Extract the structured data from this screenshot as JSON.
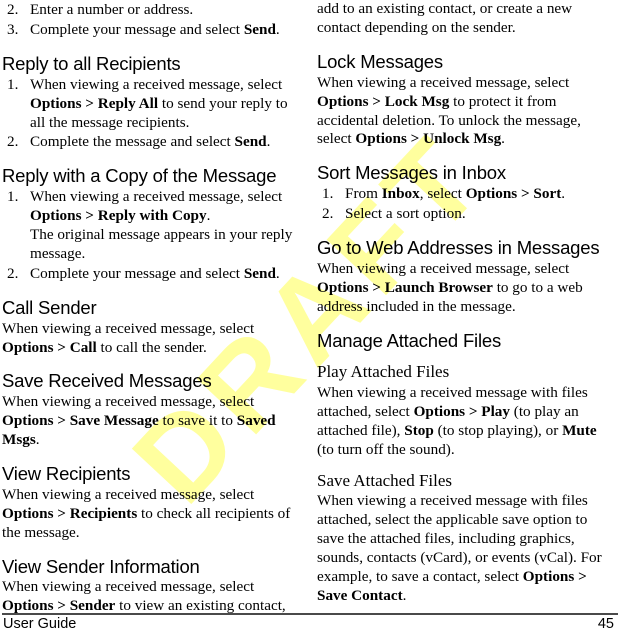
{
  "document": {
    "footer_left": "User Guide",
    "page_number": "45",
    "watermark": "DRAFT",
    "watermark_color": "#ffff9e"
  },
  "left_column": {
    "continued_steps": [
      {
        "num": "2.",
        "text_html": "Enter a number or address."
      },
      {
        "num": "3.",
        "text_html": "Complete your message and select <b>Send</b>."
      }
    ],
    "sections": [
      {
        "heading": "Reply to all Recipients",
        "heading_style": "h1",
        "steps": [
          {
            "num": "1.",
            "text_html": "When viewing a received message, select <b>Options &gt; Reply All</b> to send your reply to all the message recipients."
          },
          {
            "num": "2.",
            "text_html": "Complete the message and select <b>Send</b>."
          }
        ]
      },
      {
        "heading": "Reply with a Copy of the Message",
        "heading_style": "h1",
        "steps": [
          {
            "num": "1.",
            "text_html": "When viewing a received message, select <b>Options &gt; Reply with Copy</b>.",
            "sub_html": "The original message appears in your reply message."
          },
          {
            "num": "2.",
            "text_html": "Complete your message and select <b>Send</b>."
          }
        ]
      },
      {
        "heading": "Call Sender",
        "heading_style": "h1",
        "paragraph_html": "When viewing a received message, select <b>Options &gt; Call</b> to call the sender."
      },
      {
        "heading": "Save Received Messages",
        "heading_style": "h1",
        "paragraph_html": "When viewing a received message, select <b>Options &gt; Save Message</b> to save it to <b>Saved Msgs</b>."
      },
      {
        "heading": "View Recipients",
        "heading_style": "h1",
        "paragraph_html": "When viewing a received message, select <b>Options &gt; Recipients</b> to check all recipients of the message."
      },
      {
        "heading": "View Sender Information",
        "heading_style": "h1",
        "paragraph_html": "When viewing a received message, select <b>Options &gt; Sender</b> to view an existing contact,"
      }
    ]
  },
  "right_column": {
    "continued_paragraph_html": "add to an existing contact, or create a new contact depending on the sender.",
    "sections": [
      {
        "heading": "Lock Messages",
        "heading_style": "h1",
        "paragraph_html": "When viewing a received message, select <b>Options &gt; Lock Msg</b> to protect it from accidental deletion. To unlock the message, select <b>Options &gt; Unlock Msg</b>."
      },
      {
        "heading": "Sort Messages in Inbox",
        "heading_style": "h1",
        "steps": [
          {
            "num": "1.",
            "text_html": "From <b>Inbox</b>, select <b>Options &gt; Sort</b>."
          },
          {
            "num": "2.",
            "text_html": "Select a sort option."
          }
        ]
      },
      {
        "heading": "Go to Web Addresses in Messages",
        "heading_style": "h1",
        "paragraph_html": "When viewing a received message, select <b>Options &gt; Launch Browser</b> to go to a web address included in the message."
      },
      {
        "heading": "Manage Attached Files",
        "heading_style": "h1",
        "subsections": [
          {
            "heading": "Play Attached Files",
            "heading_style": "h2",
            "paragraph_html": "When viewing a received message with files attached, select <b>Options &gt; Play</b> (to play an attached file), <b>Stop</b> (to stop playing), or <b>Mute</b> (to turn off the sound)."
          },
          {
            "heading": "Save Attached Files",
            "heading_style": "h2",
            "paragraph_html": "When viewing a received message with files attached, select the applicable save option to save the attached files, including graphics, sounds, contacts (vCard), or events (vCal). For example, to save a contact, select <b>Options &gt; Save Contact</b>."
          }
        ]
      }
    ]
  }
}
